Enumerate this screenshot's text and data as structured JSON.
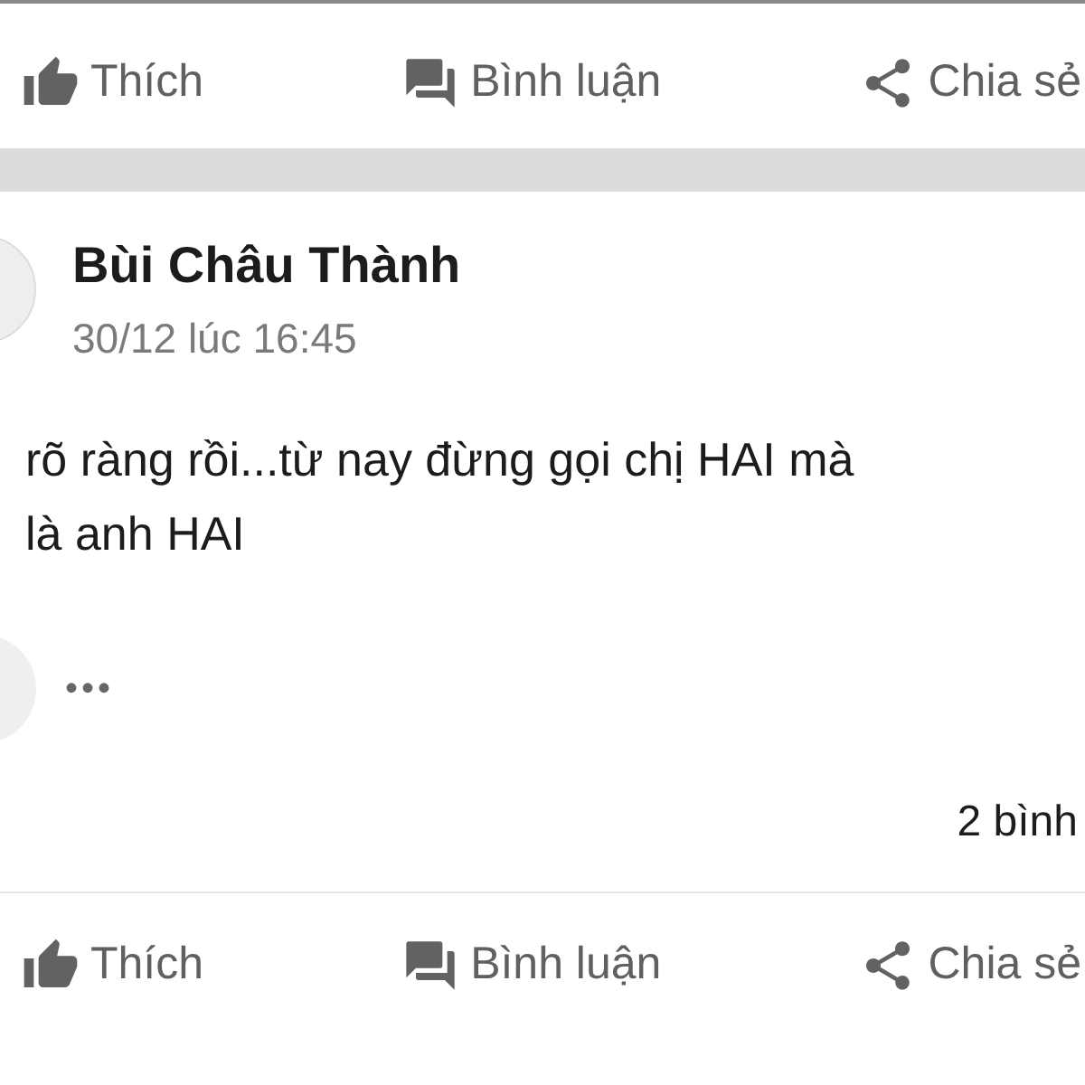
{
  "top_actions": [
    {
      "kind": "like",
      "label": "Thích"
    },
    {
      "kind": "comment",
      "label": "Bình luận"
    },
    {
      "kind": "share",
      "label": "Chia sẻ"
    }
  ],
  "post": {
    "author": "Bùi Châu Thành",
    "time": "30/12 lúc 16:45",
    "text_lines": [
      "rõ ràng rồi...từ nay đừng gọi chị HAI mà",
      "là anh HAI"
    ]
  },
  "comment_preview": {
    "text": "•••"
  },
  "comment_count": "2 bình",
  "bottom_actions": [
    {
      "kind": "like",
      "label": "Thích"
    },
    {
      "kind": "comment",
      "label": "Bình luận"
    },
    {
      "kind": "share",
      "label": "Chia sẻ"
    }
  ]
}
